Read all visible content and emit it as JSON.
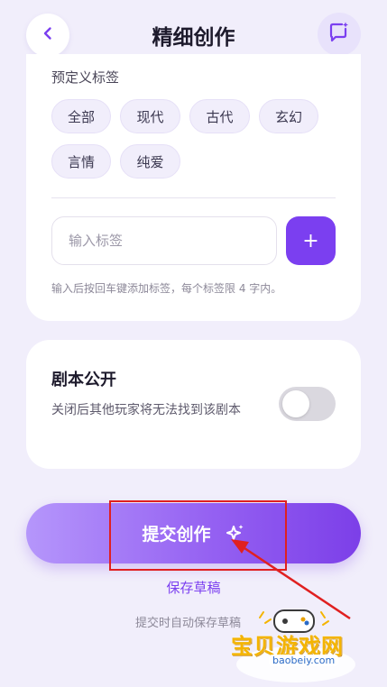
{
  "header": {
    "title": "精细创作",
    "back_icon": "chevron-left-icon",
    "action_icon": "chat-sparkle-icon"
  },
  "tags_section": {
    "label": "预定义标签",
    "chips": [
      "全部",
      "现代",
      "古代",
      "玄幻",
      "言情",
      "纯爱"
    ],
    "input_placeholder": "输入标签",
    "input_value": "",
    "add_label": "+",
    "hint": "输入后按回车键添加标签，每个标签限 4 字内。"
  },
  "public_section": {
    "title": "剧本公开",
    "description": "关闭后其他玩家将无法找到该剧本",
    "toggle_on": false
  },
  "actions": {
    "submit_label": "提交创作",
    "draft_label": "保存草稿",
    "auto_save_hint": "提交时自动保存草稿"
  },
  "watermark": {
    "text": "宝贝游戏网",
    "url": "baobeiy.com"
  },
  "colors": {
    "accent": "#7b3ff0",
    "background": "#f1eefb",
    "annotation": "#e02020"
  }
}
